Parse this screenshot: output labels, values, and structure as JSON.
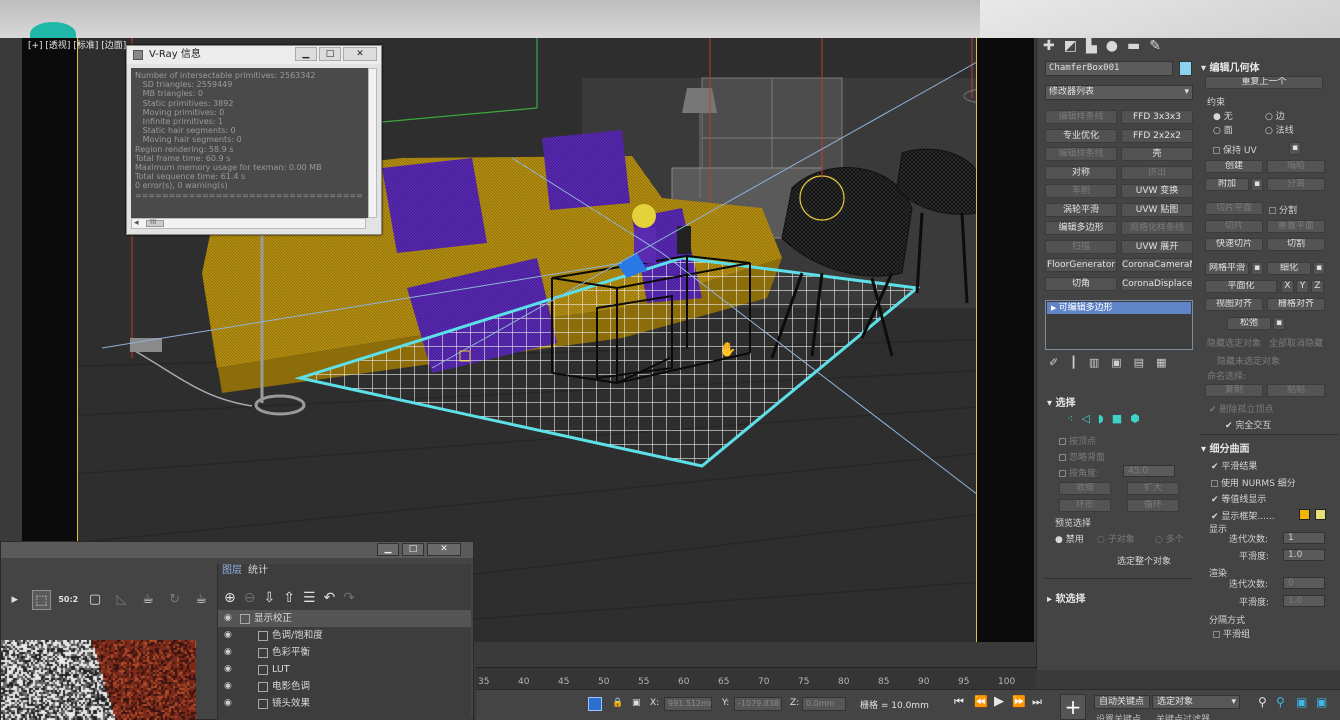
{
  "viewport": {
    "label": "[+] [透视] [标准] [边面]"
  },
  "vray_window": {
    "title": "V-Ray 信息",
    "minimize": "▁",
    "maximize": "□",
    "close": "✕",
    "lines": [
      "Number of intersectable primitives: 2563342",
      "   SD triangles: 2559449",
      "   MB triangles: 0",
      "   Static primitives: 3892",
      "   Moving primitives: 0",
      "   Infinite primitives: 1",
      "   Static hair segments: 0",
      "   Moving hair segments: 0",
      "Region rendering: 58.9 s",
      "Total frame time: 60.9 s",
      "Maximum memory usage for texman: 0.00 MB",
      "Total sequence time: 61.4 s",
      "0 error(s), 0 warning(s)",
      "=================================="
    ],
    "scroll_left": "◂",
    "scroll_thumb": "III"
  },
  "command_panel": {
    "object_name": "ChamferBox001",
    "object_color": "#8ad3f0",
    "modifier_list": "修改器列表",
    "modifier_buttons": [
      {
        "label": "编辑样条线",
        "enabled": false
      },
      {
        "label": "FFD 3x3x3",
        "enabled": true
      },
      {
        "label": "专业优化",
        "enabled": true
      },
      {
        "label": "FFD 2x2x2",
        "enabled": true
      },
      {
        "label": "编辑样条线",
        "enabled": false
      },
      {
        "label": "壳",
        "enabled": true
      },
      {
        "label": "对称",
        "enabled": true
      },
      {
        "label": "挤出",
        "enabled": false
      },
      {
        "label": "车削",
        "enabled": false
      },
      {
        "label": "UVW 变换",
        "enabled": true
      },
      {
        "label": "涡轮平滑",
        "enabled": true
      },
      {
        "label": "UVW 贴图",
        "enabled": true
      },
      {
        "label": "编辑多边形",
        "enabled": true
      },
      {
        "label": "规格化样条线",
        "enabled": false
      },
      {
        "label": "扫描",
        "enabled": false
      },
      {
        "label": "UVW 展开",
        "enabled": true
      },
      {
        "label": "FloorGenerator",
        "enabled": true
      },
      {
        "label": "CoronaCameraMod",
        "enabled": true
      },
      {
        "label": "切角",
        "enabled": true
      },
      {
        "label": "CoronaDisplacement",
        "enabled": true
      }
    ],
    "stack_item": "可编辑多边形",
    "stack_tools": [
      "✐",
      "┃",
      "▥",
      "▣",
      "▤",
      "▦"
    ],
    "selection_rollout": {
      "title": "选择",
      "by_vertex": "按顶点",
      "ignore_backfacing": "忽略背面",
      "by_angle": "按角度:",
      "angle_value": "45.0",
      "shrink": "收缩",
      "grow": "扩大",
      "ring": "环形",
      "loop": "循环",
      "preview_selection": "预览选择",
      "disabled": "禁用",
      "sub_object": "子对象",
      "multi": "多个",
      "select_whole": "选定整个对象"
    },
    "soft_selection": "软选择",
    "edit_geometry": {
      "title": "编辑几何体",
      "repeat_last": "重复上一个",
      "constraints": "约束",
      "none": "无",
      "edge": "边",
      "face": "面",
      "normal": "法线",
      "preserve_uv": "保持 UV",
      "create": "创建",
      "collapse": "塌陷",
      "attach": "附加",
      "detach": "分离",
      "slice_plane": "切片平面",
      "split": "分割",
      "slice": "切片",
      "reset_plane": "重置平面",
      "quick_slice": "快速切片",
      "cut": "切割",
      "msmooth": "网格平滑",
      "tessellate": "细化",
      "make_planar": "平面化",
      "x": "X",
      "y": "Y",
      "z": "Z",
      "view_align": "视图对齐",
      "grid_align": "栅格对齐",
      "relax": "松弛",
      "hide_selected": "隐藏选定对象",
      "unhide_all": "全部取消隐藏",
      "hide_unselected": "隐藏未选定对象",
      "named_selections": "命名选择:",
      "copy": "复制",
      "paste": "粘贴",
      "delete_isolated": "删除孤立顶点",
      "full_interactivity": "完全交互"
    },
    "subdivision_surface": {
      "title": "细分曲面",
      "smooth_result": "平滑结果",
      "use_nurms": "使用 NURMS 细分",
      "isoline_display": "等值线显示",
      "show_cage": "显示框架......",
      "cage_color_1": "#f2b400",
      "cage_color_2": "#e6e07a",
      "display": "显示",
      "iterations": "迭代次数:",
      "iterations_value": "1",
      "smoothness": "平滑度:",
      "smoothness_value": "1.0",
      "render": "渲染",
      "render_iterations": "迭代次数:",
      "render_iterations_value": "0",
      "render_smoothness": "平滑度:",
      "render_smoothness_value": "1.0",
      "separate_by": "分隔方式",
      "smoothing_groups": "平滑组"
    }
  },
  "frame_buffer": {
    "minimize": "▁",
    "maximize": "□",
    "close": "✕",
    "zoom_label": "50:2",
    "layer_tabs": [
      "图层",
      "统计"
    ],
    "layers": [
      {
        "name": "显示校正",
        "selected": true
      },
      {
        "name": "色调/饱和度",
        "selected": false
      },
      {
        "name": "色彩平衡",
        "selected": false
      },
      {
        "name": "LUT",
        "selected": false
      },
      {
        "name": "电影色调",
        "selected": false
      },
      {
        "name": "镜头效果",
        "selected": false
      }
    ]
  },
  "timeline": {
    "ticks": [
      "35",
      "40",
      "45",
      "50",
      "55",
      "60",
      "65",
      "70",
      "75",
      "80",
      "85",
      "90",
      "95",
      "100"
    ]
  },
  "status_bar": {
    "x_label": "X:",
    "x_value": "991.512mm",
    "y_label": "Y:",
    "y_value": "-1079.838",
    "z_label": "Z:",
    "z_value": "0.0mm",
    "grid": "栅格 = 10.0mm",
    "auto_key": "自动关键点",
    "selected_object": "选定对象",
    "set_key": "设置关键点",
    "key_filter": "关键点过滤器..."
  }
}
